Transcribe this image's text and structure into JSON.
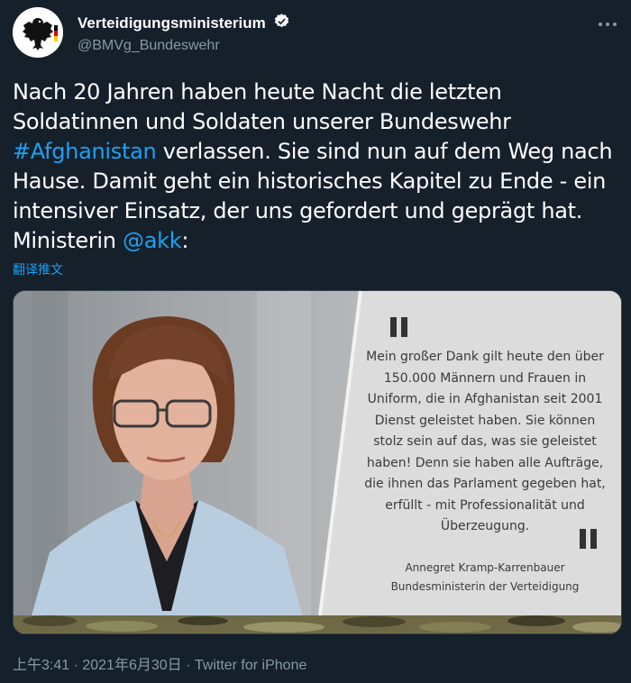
{
  "account": {
    "display_name": "Verteidigungsministerium",
    "handle": "@BMVg_Bundeswehr",
    "verified": true
  },
  "tweet": {
    "text_part1": "Nach 20 Jahren haben heute Nacht die letzten Soldatinnen und Soldaten unserer Bundeswehr ",
    "hashtag": "#Afghanistan",
    "text_part2": " verlassen. Sie sind nun auf dem Weg nach Hause. Damit geht ein historisches Kapitel zu Ende - ein intensiver Einsatz, der uns gefordert und geprägt hat. Ministerin ",
    "mention": "@akk",
    "text_part3": ":",
    "translate_label": "翻译推文"
  },
  "media": {
    "quote": "Mein großer Dank gilt heute den über 150.000 Männern und Frauen in Uniform, die in Afghanistan seit 2001 Dienst geleistet haben. Sie können stolz sein auf das, was sie geleistet haben! Denn sie haben alle Aufträge, die ihnen das Parlament gegeben hat, erfüllt - mit Professionalität und Überzeugung.",
    "attribution_name": "Annegret Kramp-Karrenbauer",
    "attribution_title": "Bundesministerin der Verteidigung"
  },
  "meta": {
    "timestamp": "上午3:41 · 2021年6月30日 · Twitter for iPhone"
  },
  "colors": {
    "background": "#15202b",
    "link": "#1da1f2",
    "secondary_text": "#8899a6"
  }
}
